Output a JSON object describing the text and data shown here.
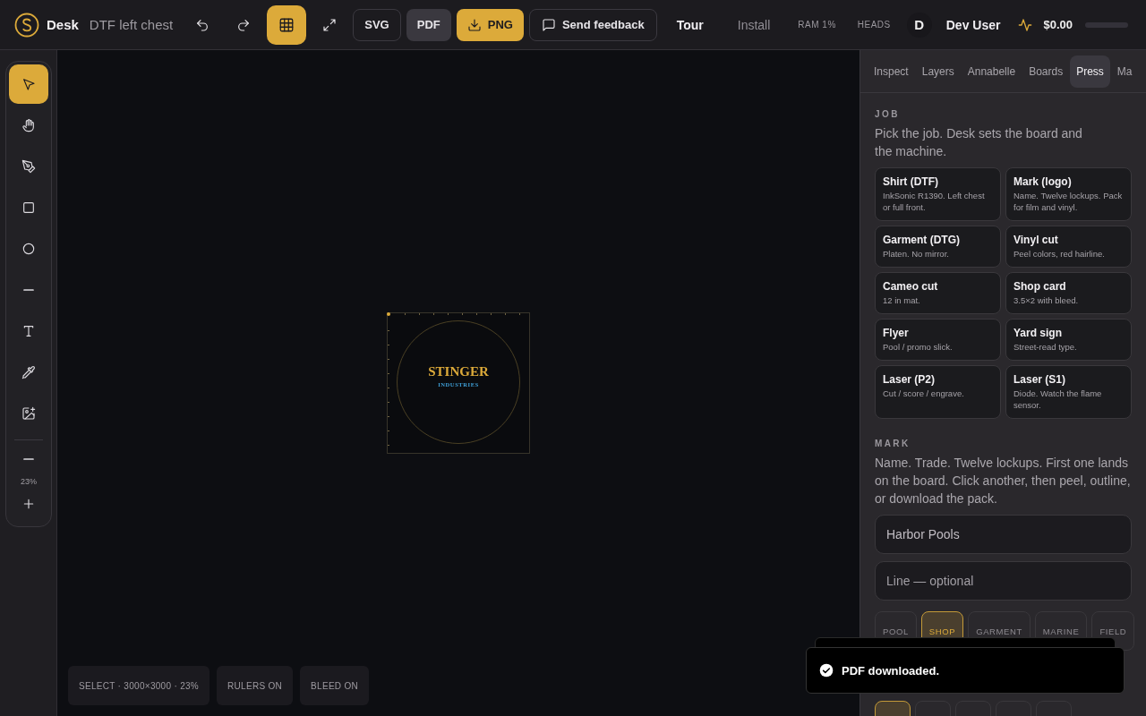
{
  "app": {
    "name": "Desk",
    "document": "DTF left chest"
  },
  "toolbar": {
    "grid_on": true,
    "exports": [
      {
        "label": "SVG",
        "kind": "outline"
      },
      {
        "label": "PDF",
        "kind": "muted"
      },
      {
        "label": "PNG",
        "kind": "primary"
      }
    ],
    "feedback": "Send feedback",
    "links": [
      {
        "label": "Tour",
        "kind": "strong"
      },
      {
        "label": "Install",
        "kind": "dim"
      }
    ],
    "ram": "RAM 1%",
    "heads": "HEADS",
    "user": {
      "initial": "D",
      "name": "Dev User"
    },
    "cost": {
      "amount": "$0.00"
    }
  },
  "tools": [
    {
      "selected": true
    },
    {
      "selected": false
    },
    {
      "selected": false
    },
    {
      "selected": false
    },
    {
      "selected": false
    },
    {
      "selected": false
    },
    {
      "selected": false
    },
    {
      "selected": false
    },
    {
      "selected": false
    }
  ],
  "zoom": "23%",
  "artboard": {
    "title": "STINGER",
    "subtitle": "INDUSTRIES"
  },
  "status_pills": [
    "SELECT · 3000×3000 · 23%",
    "RULERS ON",
    "BLEED ON"
  ],
  "panel": {
    "tabs": [
      {
        "label": "Inspect",
        "selected": false
      },
      {
        "label": "Layers",
        "selected": false
      },
      {
        "label": "Annabelle",
        "selected": false
      },
      {
        "label": "Boards",
        "selected": false
      },
      {
        "label": "Press",
        "selected": true
      },
      {
        "label": "Ma",
        "selected": false
      }
    ],
    "job": {
      "heading": "JOB",
      "text": "Pick the job. Desk sets the board and the machine.",
      "cards": [
        {
          "title": "Shirt (DTF)",
          "text": "InkSonic R1390. Left chest or full front."
        },
        {
          "title": "Mark (logo)",
          "text": "Name. Twelve lockups. Pack for film and vinyl."
        },
        {
          "title": "Garment (DTG)",
          "text": "Platen. No mirror."
        },
        {
          "title": "Vinyl cut",
          "text": "Peel colors, red hairline."
        },
        {
          "title": "Cameo cut",
          "text": "12 in mat."
        },
        {
          "title": "Shop card",
          "text": "3.5×2 with bleed."
        },
        {
          "title": "Flyer",
          "text": "Pool / promo slick."
        },
        {
          "title": "Yard sign",
          "text": "Street-read type."
        },
        {
          "title": "Laser (P2)",
          "text": "Cut / score / engrave."
        },
        {
          "title": "Laser (S1)",
          "text": "Diode. Watch the flame sensor."
        }
      ]
    },
    "mark": {
      "heading": "MARK",
      "text": "Name. Trade. Twelve lockups. First one lands on the board. Click another, then peel, outline, or download the pack.",
      "name_field": {
        "value": "Harbor Pools"
      },
      "line_field": {
        "placeholder": "Line — optional"
      },
      "lockups": [
        {
          "label": "POOL",
          "selected": false
        },
        {
          "label": "SHOP",
          "selected": true
        },
        {
          "label": "GARMENT",
          "selected": false
        },
        {
          "label": "MARINE",
          "selected": false
        },
        {
          "label": "FIELD",
          "selected": false
        }
      ],
      "swatches": [
        {
          "selected": true
        },
        {
          "selected": false
        },
        {
          "selected": false
        },
        {
          "selected": false
        },
        {
          "selected": false
        }
      ]
    }
  },
  "toast": {
    "text": "PDF downloaded."
  }
}
